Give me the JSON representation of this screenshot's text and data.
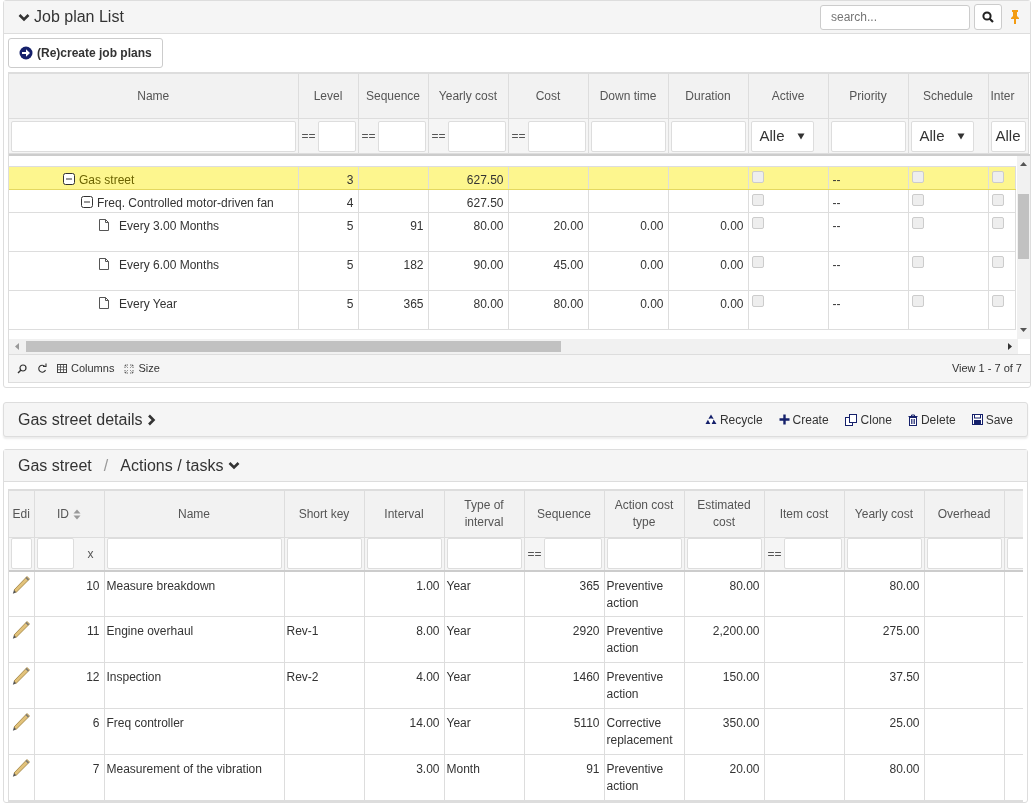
{
  "job_plan_panel": {
    "title": "Job plan List",
    "search": {
      "placeholder": "search..."
    },
    "recreate_button": "(Re)create job plans",
    "grid": {
      "columns": [
        {
          "label": "Name",
          "filter": {
            "kind": "input"
          }
        },
        {
          "label": "Level",
          "filter": {
            "kind": "compare",
            "operator": "=="
          }
        },
        {
          "label": "Sequence",
          "filter": {
            "kind": "compare",
            "operator": "=="
          }
        },
        {
          "label": "Yearly cost",
          "filter": {
            "kind": "compare",
            "operator": "=="
          }
        },
        {
          "label": "Cost",
          "filter": {
            "kind": "compare",
            "operator": "=="
          }
        },
        {
          "label": "Down time",
          "filter": {
            "kind": "input"
          }
        },
        {
          "label": "Duration",
          "filter": {
            "kind": "input"
          }
        },
        {
          "label": "Active",
          "filter": {
            "kind": "dropdown",
            "value": "Alle"
          }
        },
        {
          "label": "Priority",
          "filter": {
            "kind": "input"
          }
        },
        {
          "label": "Schedule",
          "filter": {
            "kind": "dropdown",
            "value": "Alle"
          }
        },
        {
          "label": "Inter",
          "filter": {
            "kind": "dropdown",
            "value": "Alle"
          }
        }
      ],
      "rows": [
        {
          "kind": "folder",
          "name": "Gas street",
          "expanded": true,
          "selected": true,
          "level": "3",
          "yearly_cost": "627.50",
          "active": false,
          "priority": "--",
          "schedule": false,
          "column_11": false,
          "children": [
            {
              "kind": "folder",
              "name": "Freq. Controlled motor-driven fan",
              "expanded": true,
              "selected": false,
              "level": "4",
              "yearly_cost": "627.50",
              "active": false,
              "priority": "--",
              "schedule": false,
              "column_11": false,
              "children": [
                {
                  "kind": "leaf",
                  "name": "Every 3.00 Months",
                  "selected": false,
                  "level": "5",
                  "sequence": "91",
                  "yearly_cost": "80.00",
                  "cost": "20.00",
                  "down_time": "0.00",
                  "duration": "0.00",
                  "active": false,
                  "priority": "--",
                  "schedule": false,
                  "column_11": false
                },
                {
                  "kind": "leaf",
                  "name": "Every 6.00 Months",
                  "selected": false,
                  "level": "5",
                  "sequence": "182",
                  "yearly_cost": "90.00",
                  "cost": "45.00",
                  "down_time": "0.00",
                  "duration": "0.00",
                  "active": false,
                  "priority": "--",
                  "schedule": false,
                  "column_11": false
                },
                {
                  "kind": "leaf",
                  "name": "Every Year",
                  "selected": false,
                  "level": "5",
                  "sequence": "365",
                  "yearly_cost": "80.00",
                  "cost": "80.00",
                  "down_time": "0.00",
                  "duration": "0.00",
                  "active": false,
                  "priority": "--",
                  "schedule": false,
                  "column_11": false
                }
              ]
            }
          ]
        }
      ]
    },
    "footer": {
      "tools": [
        {
          "kind": "search"
        },
        {
          "kind": "refresh"
        },
        {
          "kind": "columns",
          "label": "Columns"
        },
        {
          "kind": "size",
          "label": "Size"
        }
      ],
      "pager": "View 1 - 7 of 7"
    }
  },
  "details_panel": {
    "title": "Gas street details",
    "toolbar": [
      {
        "kind": "recycle",
        "label": "Recycle"
      },
      {
        "kind": "create",
        "label": "Create"
      },
      {
        "kind": "clone",
        "label": "Clone"
      },
      {
        "kind": "delete",
        "label": "Delete"
      },
      {
        "kind": "save",
        "label": "Save"
      }
    ]
  },
  "actions_panel": {
    "breadcrumb": [
      "Gas street",
      "Actions / tasks"
    ],
    "breadcrumb_separator": "/",
    "grid": {
      "columns": [
        {
          "label": "Edi",
          "filter": {
            "kind": "input"
          }
        },
        {
          "label": "ID",
          "filter": {
            "kind": "clearable",
            "clear": "x"
          },
          "sortable": true
        },
        {
          "label": "Name",
          "filter": {
            "kind": "input"
          }
        },
        {
          "label": "Short key",
          "filter": {
            "kind": "input"
          }
        },
        {
          "label": "Interval",
          "filter": {
            "kind": "input"
          }
        },
        {
          "label": "Type of interval",
          "filter": {
            "kind": "input"
          }
        },
        {
          "label": "Sequence",
          "filter": {
            "kind": "compare",
            "operator": "=="
          }
        },
        {
          "label": "Action cost type",
          "filter": {
            "kind": "input"
          }
        },
        {
          "label": "Estimated cost",
          "filter": {
            "kind": "input"
          }
        },
        {
          "label": "Item cost",
          "filter": {
            "kind": "compare",
            "operator": "=="
          }
        },
        {
          "label": "Yearly cost",
          "filter": {
            "kind": "input"
          }
        },
        {
          "label": "Overhead",
          "filter": {
            "kind": "input"
          }
        },
        {
          "filter": {
            "kind": "input"
          }
        }
      ],
      "rows": [
        {
          "id": "10",
          "name": "Measure breakdown",
          "interval": "1.00",
          "interval_type": "Year",
          "sequence": "365",
          "action_cost_type": "Preventive action",
          "estimated_cost": "80.00",
          "yearly_cost": "80.00"
        },
        {
          "id": "11",
          "name": "Engine overhaul",
          "short_key": "Rev-1",
          "interval": "8.00",
          "interval_type": "Year",
          "sequence": "2920",
          "action_cost_type": "Preventive action",
          "estimated_cost": "2,200.00",
          "yearly_cost": "275.00"
        },
        {
          "id": "12",
          "name": "Inspection",
          "short_key": "Rev-2",
          "interval": "4.00",
          "interval_type": "Year",
          "sequence": "1460",
          "action_cost_type": "Preventive action",
          "estimated_cost": "150.00",
          "yearly_cost": "37.50"
        },
        {
          "id": "6",
          "name": "Freq controller",
          "interval": "14.00",
          "interval_type": "Year",
          "sequence": "5110",
          "action_cost_type": "Corrective replacement",
          "estimated_cost": "350.00",
          "yearly_cost": "25.00"
        },
        {
          "id": "7",
          "name": "Measurement of the vibration",
          "interval": "3.00",
          "interval_type": "Month",
          "sequence": "91",
          "action_cost_type": "Preventive action",
          "estimated_cost": "20.00",
          "yearly_cost": "80.00"
        }
      ]
    }
  }
}
